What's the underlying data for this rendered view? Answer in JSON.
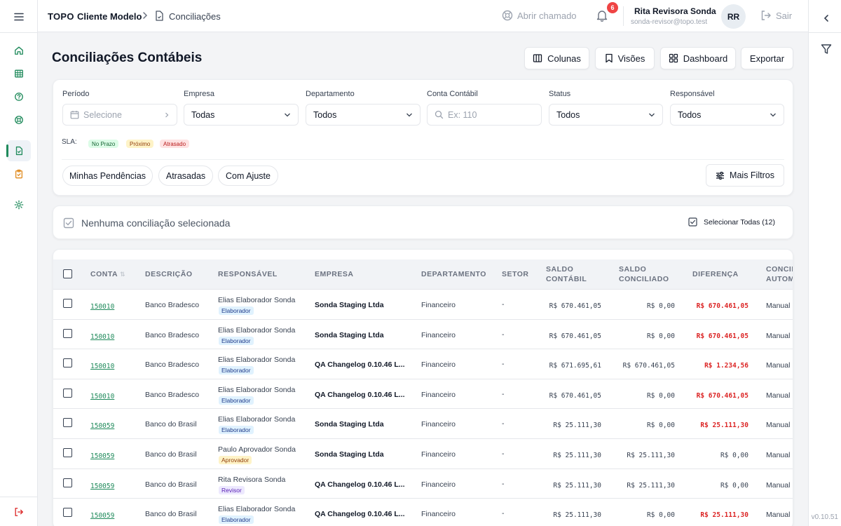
{
  "header": {
    "brand": "TOPO",
    "client": "Cliente Modelo",
    "page": "Conciliações",
    "ticket": "Abrir chamado",
    "notifications": "6",
    "user_name": "Rita Revisora Sonda",
    "user_email": "sonda-revisor@topo.test",
    "avatar": "RR",
    "logout": "Sair"
  },
  "title": "Conciliações Contábeis",
  "toolbar": {
    "columns": "Colunas",
    "views": "Visões",
    "dashboard": "Dashboard",
    "export": "Exportar"
  },
  "filters": {
    "period": {
      "label": "Período",
      "placeholder": "Selecione"
    },
    "company": {
      "label": "Empresa",
      "value": "Todas"
    },
    "department": {
      "label": "Departamento",
      "value": "Todos"
    },
    "account": {
      "label": "Conta Contábil",
      "placeholder": "Ex: 110"
    },
    "status": {
      "label": "Status",
      "value": "Todos"
    },
    "owner": {
      "label": "Responsável",
      "value": "Todos"
    },
    "sla_label": "SLA:",
    "sla": [
      "No Prazo",
      "Próximo",
      "Atrasado"
    ],
    "quick": [
      "Minhas Pendências",
      "Atrasadas",
      "Com Ajuste"
    ],
    "more": "Mais Filtros"
  },
  "selection": {
    "text": "Nenhuma conciliação selecionada",
    "select_all": "Selecionar Todas (12)"
  },
  "table": {
    "columns": [
      "CONTA",
      "DESCRIÇÃO",
      "RESPONSÁVEL",
      "EMPRESA",
      "DEPARTAMENTO",
      "SETOR",
      "SALDO",
      "CONTÁBIL",
      "SALDO",
      "CONCILIADO",
      "DIFERENÇA",
      "CONCIL",
      "AUTOM"
    ],
    "rows": [
      {
        "account": "150010",
        "desc": "Banco Bradesco",
        "owner": "Elias Elaborador Sonda",
        "role": "Elaborador",
        "company": "Sonda Staging Ltda",
        "dept": "Financeiro",
        "sector": "-",
        "bal": "R$ 670.461,05",
        "conc": "R$ 0,00",
        "diff": "R$ 670.461,05",
        "mode": "Manual"
      },
      {
        "account": "150010",
        "desc": "Banco Bradesco",
        "owner": "Elias Elaborador Sonda",
        "role": "Elaborador",
        "company": "Sonda Staging Ltda",
        "dept": "Financeiro",
        "sector": "-",
        "bal": "R$ 670.461,05",
        "conc": "R$ 0,00",
        "diff": "R$ 670.461,05",
        "mode": "Manual"
      },
      {
        "account": "150010",
        "desc": "Banco Bradesco",
        "owner": "Elias Elaborador Sonda",
        "role": "Elaborador",
        "company": "QA Changelog 0.10.46 L...",
        "dept": "Financeiro",
        "sector": "-",
        "bal": "R$ 671.695,61",
        "conc": "R$ 670.461,05",
        "diff": "R$ 1.234,56",
        "mode": "Manual"
      },
      {
        "account": "150010",
        "desc": "Banco Bradesco",
        "owner": "Elias Elaborador Sonda",
        "role": "Elaborador",
        "company": "QA Changelog 0.10.46 L...",
        "dept": "Financeiro",
        "sector": "-",
        "bal": "R$ 670.461,05",
        "conc": "R$ 0,00",
        "diff": "R$ 670.461,05",
        "mode": "Manual"
      },
      {
        "account": "150059",
        "desc": "Banco do Brasil",
        "owner": "Elias Elaborador Sonda",
        "role": "Elaborador",
        "company": "Sonda Staging Ltda",
        "dept": "Financeiro",
        "sector": "-",
        "bal": "R$ 25.111,30",
        "conc": "R$ 0,00",
        "diff": "R$ 25.111,30",
        "mode": "Manual"
      },
      {
        "account": "150059",
        "desc": "Banco do Brasil",
        "owner": "Paulo Aprovador Sonda",
        "role": "Aprovador",
        "company": "Sonda Staging Ltda",
        "dept": "Financeiro",
        "sector": "-",
        "bal": "R$ 25.111,30",
        "conc": "R$ 25.111,30",
        "diff": "R$ 0,00",
        "mode": "Manual"
      },
      {
        "account": "150059",
        "desc": "Banco do Brasil",
        "owner": "Rita Revisora Sonda",
        "role": "Revisor",
        "company": "QA Changelog 0.10.46 L...",
        "dept": "Financeiro",
        "sector": "-",
        "bal": "R$ 25.111,30",
        "conc": "R$ 25.111,30",
        "diff": "R$ 0,00",
        "mode": "Manual"
      },
      {
        "account": "150059",
        "desc": "Banco do Brasil",
        "owner": "Elias Elaborador Sonda",
        "role": "Elaborador",
        "company": "QA Changelog 0.10.46 L...",
        "dept": "Financeiro",
        "sector": "-",
        "bal": "R$ 25.111,30",
        "conc": "R$ 0,00",
        "diff": "R$ 25.111,30",
        "mode": "Manual"
      }
    ]
  },
  "version": "v0.10.51"
}
